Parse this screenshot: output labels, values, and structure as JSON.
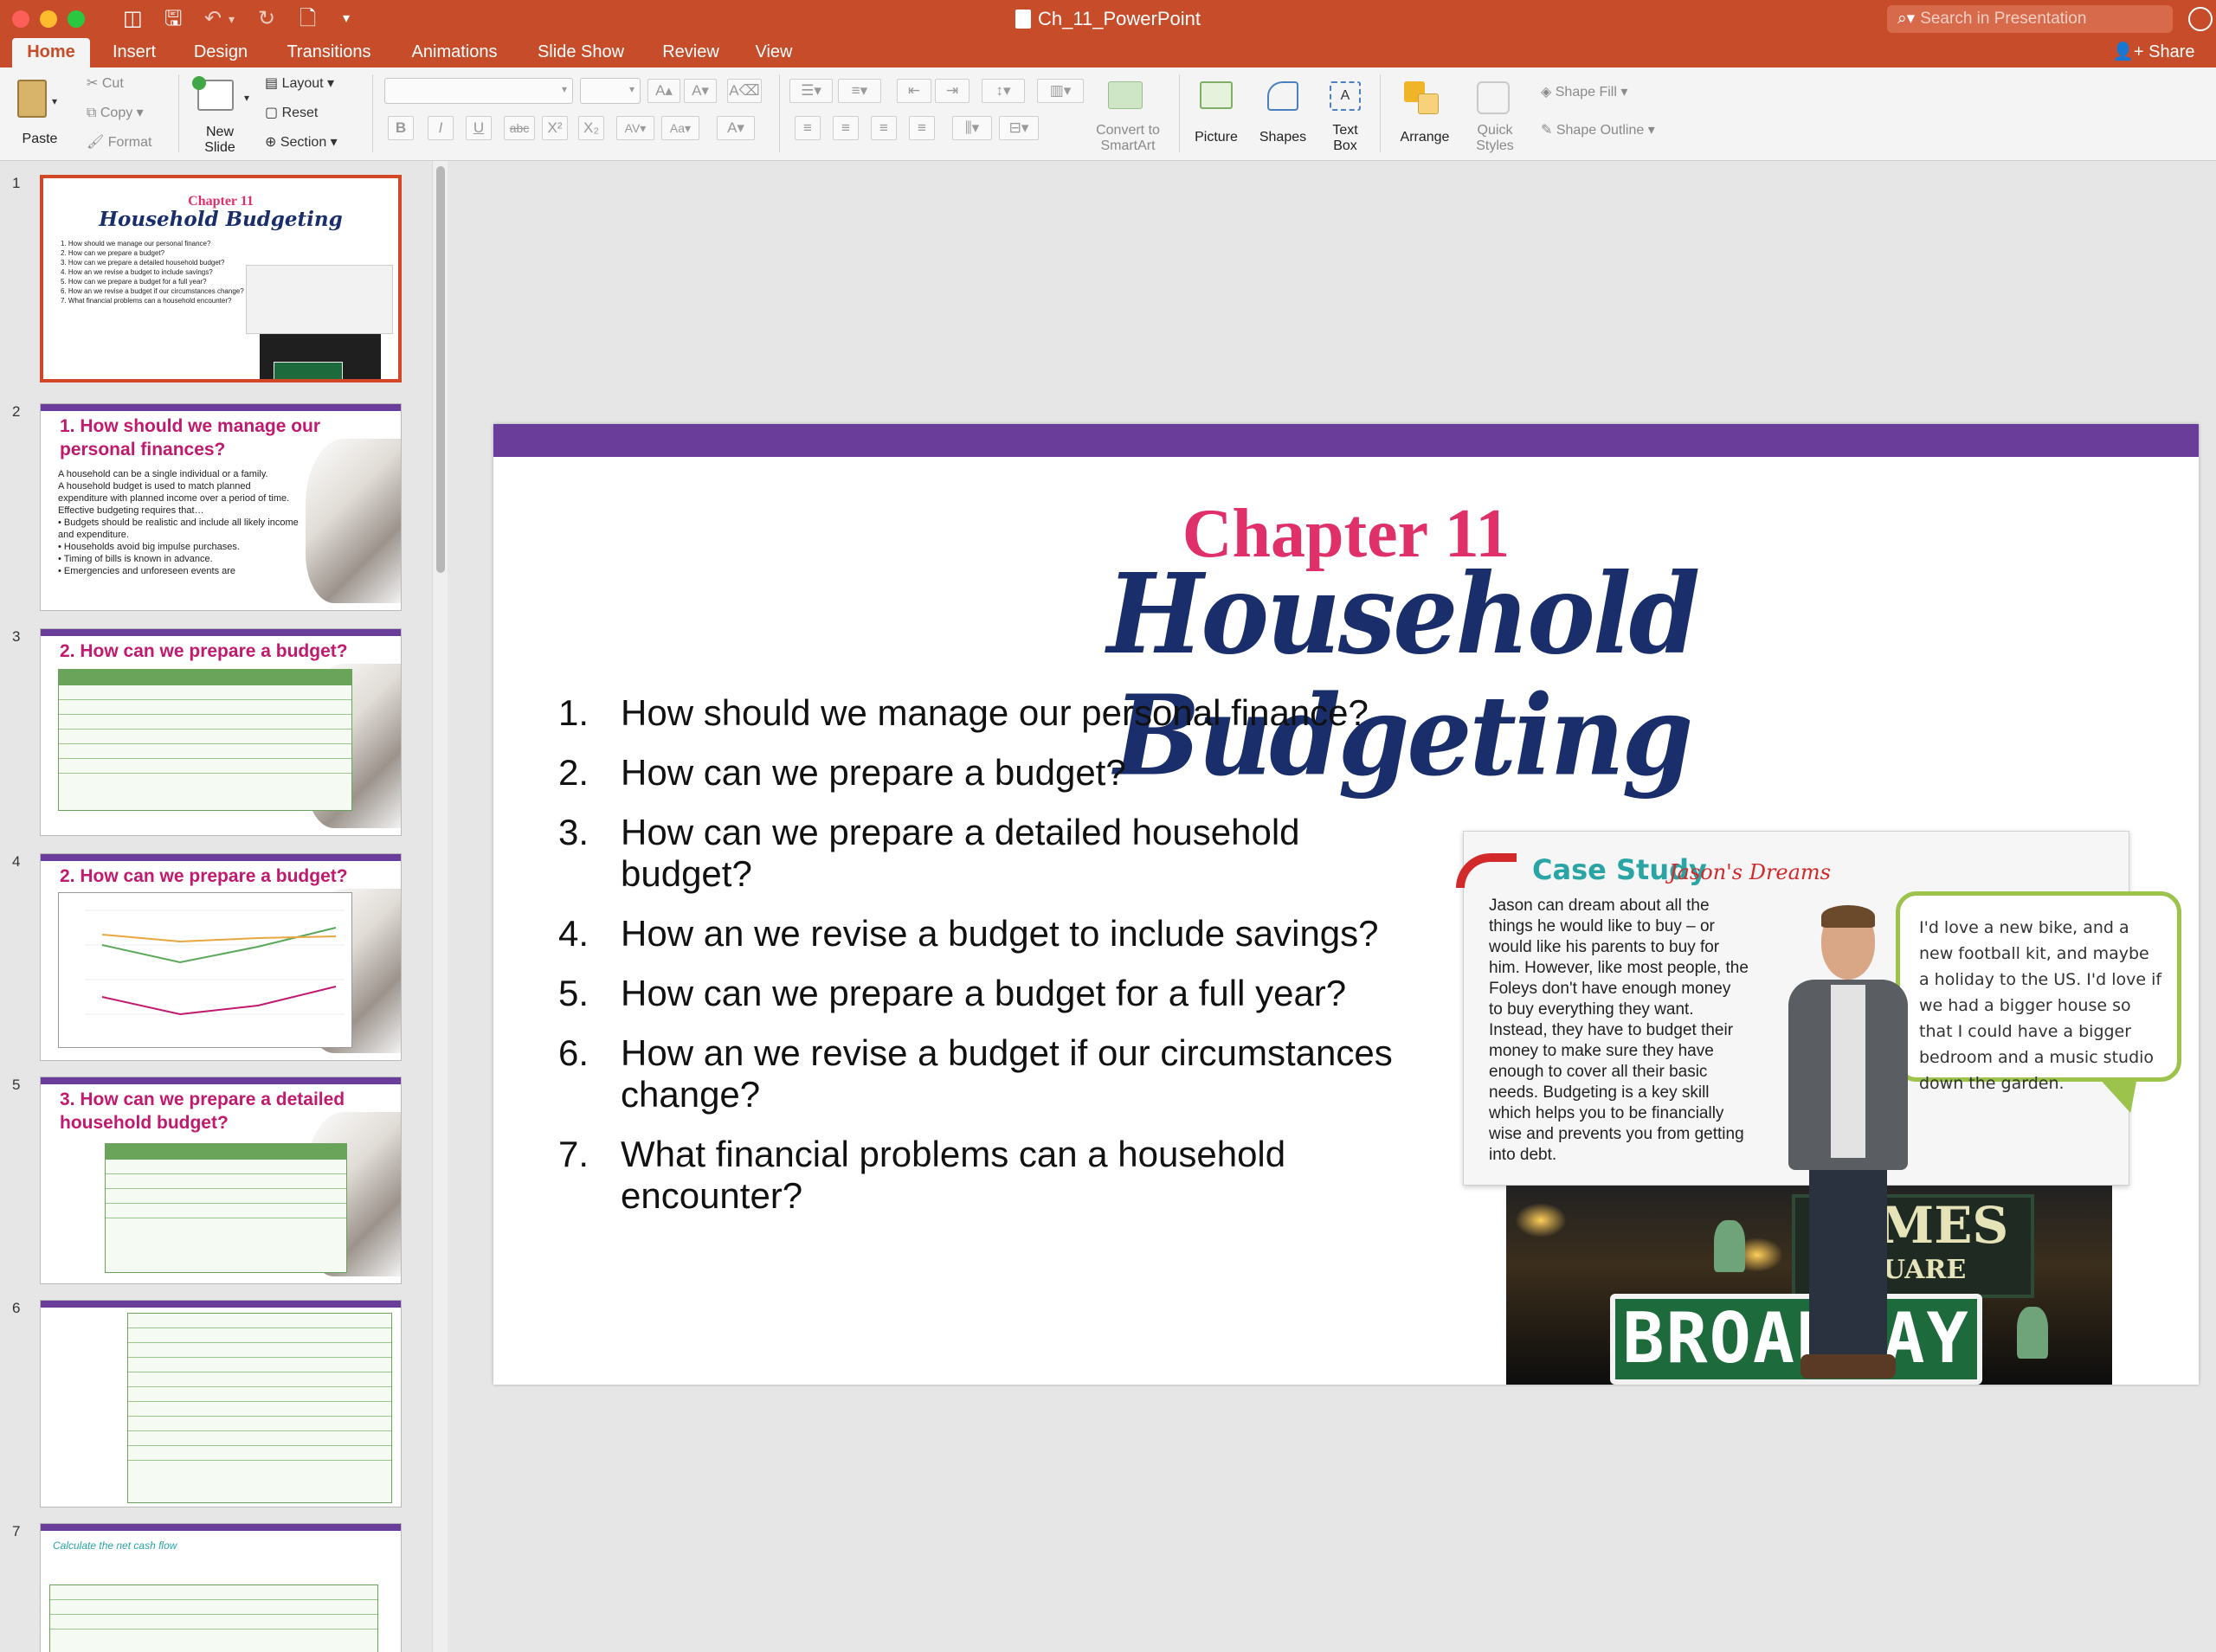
{
  "app": {
    "doc_title": "Ch_11_PowerPoint",
    "search_placeholder": "Search in Presentation",
    "share_label": "Share"
  },
  "tabs": [
    "Home",
    "Insert",
    "Design",
    "Transitions",
    "Animations",
    "Slide Show",
    "Review",
    "View"
  ],
  "active_tab": "Home",
  "ribbon": {
    "paste": "Paste",
    "cut": "Cut",
    "copy": "Copy",
    "format": "Format",
    "new_slide_1": "New",
    "new_slide_2": "Slide",
    "layout": "Layout",
    "reset": "Reset",
    "section": "Section",
    "convert_1": "Convert to",
    "convert_2": "SmartArt",
    "picture": "Picture",
    "shapes": "Shapes",
    "textbox_1": "Text",
    "textbox_2": "Box",
    "arrange": "Arrange",
    "quick_1": "Quick",
    "quick_2": "Styles",
    "shape_fill": "Shape Fill",
    "shape_outline": "Shape Outline"
  },
  "thumbnails": [
    {
      "num": "1",
      "title": "Household Budgeting",
      "chapter": "Chapter 11"
    },
    {
      "num": "2",
      "title": "1. How should we manage our personal finances?",
      "lines": [
        "A household can be a single individual or a family.",
        "A household budget is used to match planned expenditure with planned income over a period of time.",
        "Effective budgeting requires that…",
        "• Budgets should be realistic and include all likely income and expenditure.",
        "• Households avoid big impulse purchases.",
        "• Timing of bills is known in advance.",
        "• Emergencies and unforeseen events are"
      ]
    },
    {
      "num": "3",
      "title": "2. How can we prepare a budget?"
    },
    {
      "num": "4",
      "title": "2. How can we prepare a budget?"
    },
    {
      "num": "5",
      "title": "3. How can we prepare a detailed household budget?"
    },
    {
      "num": "6",
      "title": ""
    },
    {
      "num": "7",
      "title": "Calculate the net cash flow"
    }
  ],
  "slide": {
    "chapter": "Chapter 11",
    "title": "Household Budgeting",
    "questions": [
      "How should we manage our personal finance?",
      "How can we prepare a budget?",
      "How can we prepare a detailed household budget?",
      "How an we revise a budget to include savings?",
      "How can we prepare a budget for a full year?",
      "How an we revise a budget if our circumstances change?",
      "What financial problems can a household encounter?"
    ],
    "case_study": {
      "heading": "Case Study",
      "subheading": "Jason's Dreams",
      "body": "Jason can dream about all the things he would like to buy – or would like his parents to buy for him. However, like most people, the Foleys don't have enough money to buy everything they want. Instead, they have to budget their money to make sure they have enough to cover all their basic needs. Budgeting is a key skill which helps you to be financially wise and prevents you from getting into debt.",
      "bubble": "I'd love a new bike, and a new football kit, and maybe a holiday to the US. I'd love if we had a bigger house so that I could have a bigger bedroom and a music studio down the garden."
    },
    "photo": {
      "times": "TIMES",
      "square": "QUARE",
      "broadway": "BROADWAY"
    }
  },
  "colors": {
    "brand": "#c64c2a",
    "slide_bar": "#6a3d9a",
    "chapter": "#e0306a",
    "title": "#1a2e6c"
  }
}
